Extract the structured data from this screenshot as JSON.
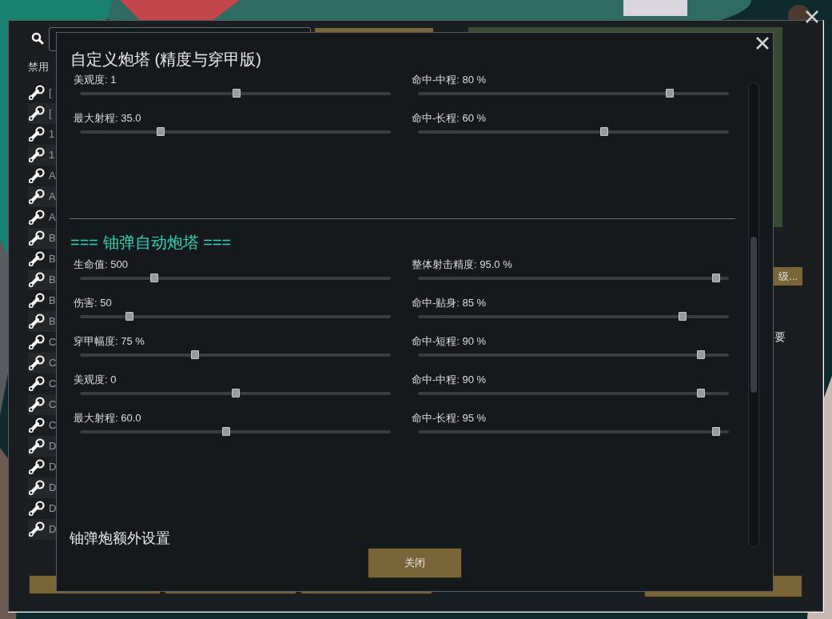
{
  "outer_window": {
    "filter_label": "禁用",
    "mods": [
      "[",
      "[",
      "1",
      "1",
      "A",
      "A",
      "A",
      "B",
      "B",
      "B",
      "B",
      "B",
      "C",
      "C",
      "C",
      "C",
      "C",
      "D",
      "D",
      "D",
      "D",
      "D"
    ],
    "side_button": "级...",
    "side_text": "要"
  },
  "dialog": {
    "title": "自定义炮塔 (精度与穿甲版)",
    "groups": [
      {
        "left": [
          {
            "label": "美观度: 1",
            "level": 0.505
          },
          {
            "label": "最大射程: 35.0",
            "level": 0.26
          }
        ],
        "right": [
          {
            "label": "命中-中程: 80 %",
            "level": 0.81
          },
          {
            "label": "命中-长程: 60 %",
            "level": 0.6
          }
        ]
      },
      {
        "heading": "=== 铀弹自动炮塔 ===",
        "left": [
          {
            "label": "生命值: 500",
            "level": 0.24
          },
          {
            "label": "伤害: 50",
            "level": 0.16
          },
          {
            "label": "穿甲幅度: 75 %",
            "level": 0.37
          },
          {
            "label": "美观度: 0",
            "level": 0.5
          },
          {
            "label": "最大射程: 60.0",
            "level": 0.47
          }
        ],
        "right": [
          {
            "label": "整体射击精度: 95.0 %",
            "level": 0.96
          },
          {
            "label": "命中-贴身: 85 %",
            "level": 0.85
          },
          {
            "label": "命中-短程: 90 %",
            "level": 0.91
          },
          {
            "label": "命中-中程: 90 %",
            "level": 0.91
          },
          {
            "label": "命中-长程: 95 %",
            "level": 0.96
          }
        ]
      }
    ],
    "next_heading": "铀弹炮额外设置",
    "close_button": "关闭"
  }
}
